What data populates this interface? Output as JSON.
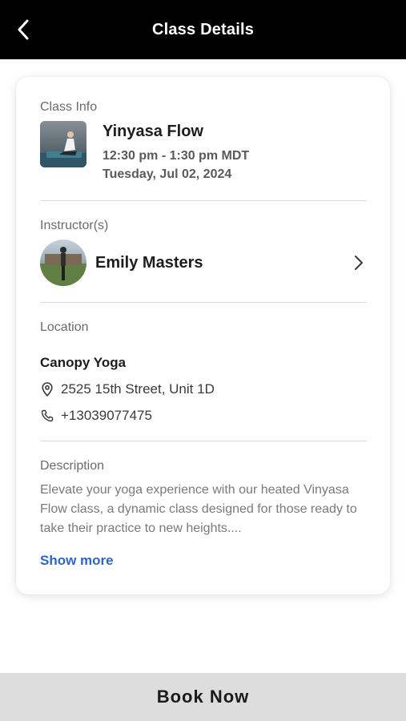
{
  "header": {
    "title": "Class Details",
    "back_icon": "chevron-left-icon"
  },
  "class_info": {
    "section_label": "Class Info",
    "name": "Yinyasa Flow",
    "time": "12:30 pm - 1:30 pm MDT",
    "date": "Tuesday, Jul 02, 2024"
  },
  "instructors": {
    "section_label": "Instructor(s)",
    "name": "Emily Masters",
    "chevron_icon": "chevron-right-icon"
  },
  "location": {
    "section_label": "Location",
    "studio_name": "Canopy Yoga",
    "address": "2525 15th Street, Unit 1D",
    "phone": "+13039077475",
    "address_icon": "map-pin-icon",
    "phone_icon": "phone-icon"
  },
  "description": {
    "section_label": "Description",
    "text": "Elevate your yoga experience with our heated Vinyasa Flow class, a dynamic class designed for those ready to take their practice to new heights....",
    "show_more_label": "Show more"
  },
  "footer": {
    "book_label": "Book Now"
  },
  "colors": {
    "header_bg": "#000000",
    "link": "#2a66d0",
    "book_bg": "#dddddd"
  }
}
